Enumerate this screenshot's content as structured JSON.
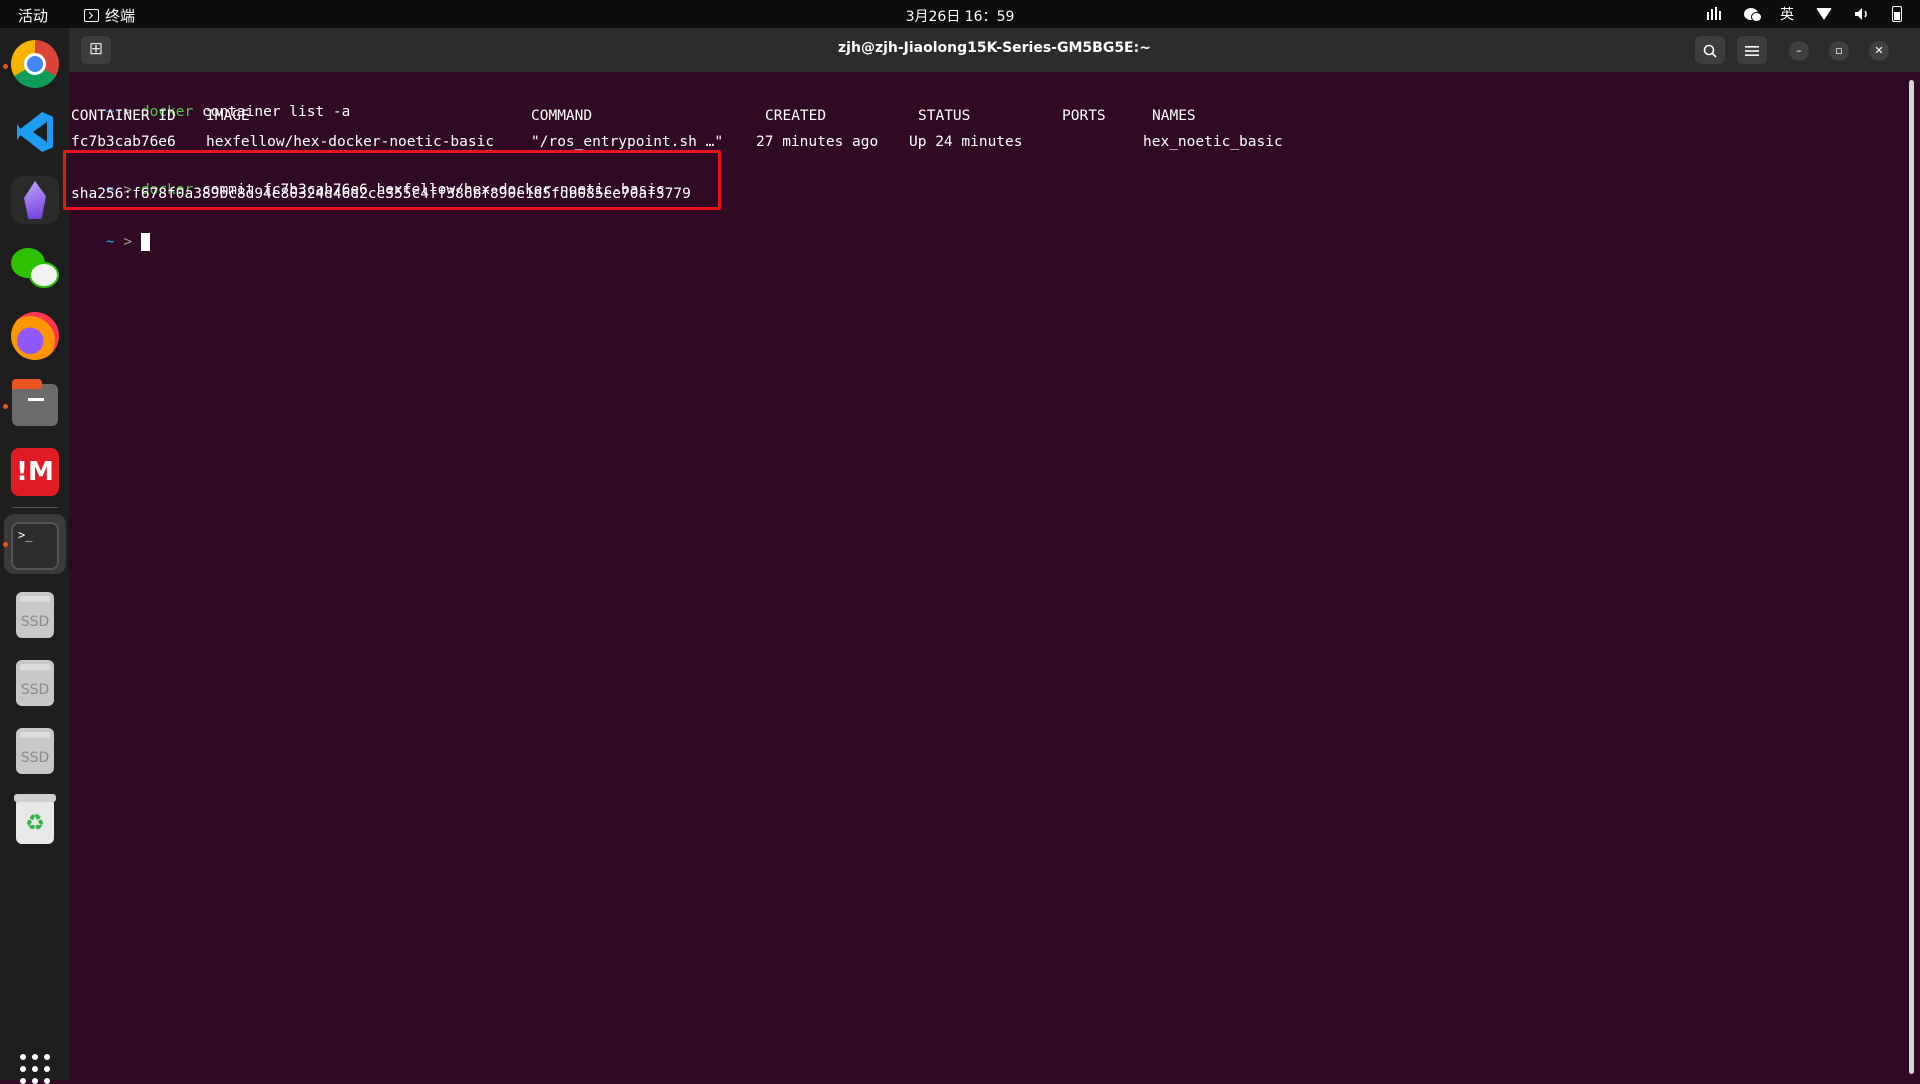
{
  "topbar": {
    "activities": "活动",
    "app_name": "终端",
    "clock": "3月26日  16：59",
    "input_method": "英"
  },
  "window": {
    "title": "zjh@zjh-Jiaolong15K-Series-GM5BG5E:~"
  },
  "terminal": {
    "prompt_tilde": "~",
    "prompt_arrow": ">",
    "line1": {
      "cmd": "docker",
      "args": " container list -a"
    },
    "table": {
      "headers": [
        "CONTAINER ID",
        "IMAGE",
        "COMMAND",
        "CREATED",
        "STATUS",
        "PORTS",
        "NAMES"
      ],
      "row": [
        "fc7b3cab76e6",
        "hexfellow/hex-docker-noetic-basic",
        "\"/ros_entrypoint.sh …\"",
        "27 minutes ago",
        "Up 24 minutes",
        "",
        "hex_noetic_basic"
      ]
    },
    "line2": {
      "cmd": "docker",
      "args": " commit fc7b3cab76e6 hexfellow/hex-docker-noetic-basic"
    },
    "output": "sha256:f678f0a389bc8d94e80324d46d2ce355c4ff386bf890e1d5fdb085ee70af3779"
  },
  "dock": {
    "items": [
      "chrome-icon",
      "vscode-icon",
      "obsidian-icon",
      "wechat-icon",
      "firefox-icon",
      "files-icon",
      "mi-icon",
      "terminal-icon",
      "ssd-drive-icon",
      "ssd-drive-icon",
      "ssd-drive-icon",
      "trash-icon",
      "show-apps-icon"
    ],
    "ssd_label": "SSD",
    "terminal_glyph": ">_",
    "mi_label": "!M",
    "trash_glyph": "♻"
  },
  "colors": {
    "terminal_bg": "#300a24",
    "highlight_border": "#e8141b",
    "prompt_tilde": "#2aa1ff",
    "command": "#4ec94e"
  }
}
